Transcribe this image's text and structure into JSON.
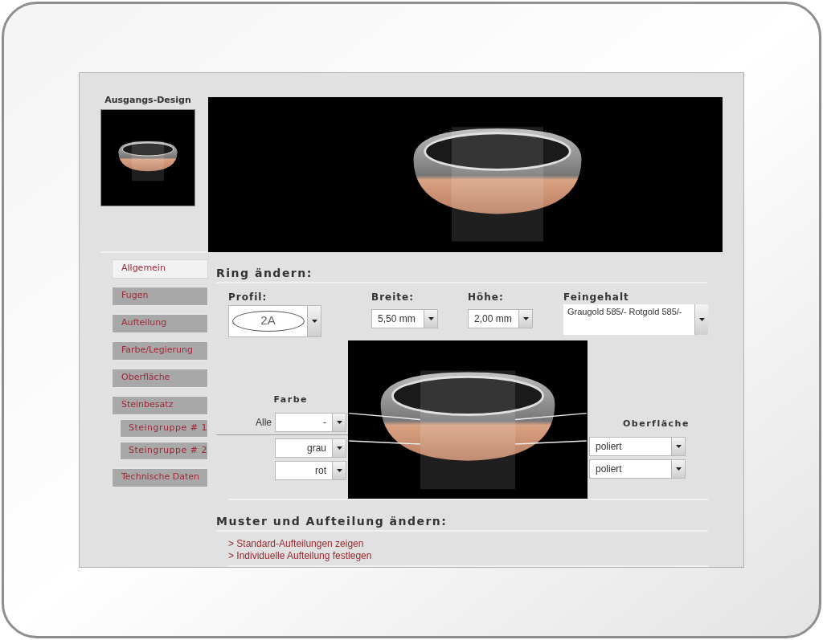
{
  "thumbnail": {
    "title": "Ausgangs-Design"
  },
  "nav": {
    "items": [
      {
        "label": "Allgemein",
        "selected": true
      },
      {
        "label": "Fugen",
        "selected": false
      },
      {
        "label": "Aufteilung",
        "selected": false
      },
      {
        "label": "Farbe/Legierung",
        "selected": false
      },
      {
        "label": "Oberfläche",
        "selected": false
      },
      {
        "label": "Steinbesatz",
        "selected": false,
        "children": [
          {
            "label": "Steingruppe # 1",
            "selected": false
          },
          {
            "label": "Steingruppe # 2",
            "selected": false
          }
        ]
      },
      {
        "label": "Technische Daten",
        "selected": false
      }
    ]
  },
  "ring_section": {
    "title": "Ring ändern:",
    "profil": {
      "label": "Profil:",
      "value": "2A"
    },
    "breite": {
      "label": "Breite:",
      "value": "5,50 mm"
    },
    "hoehe": {
      "label": "Höhe:",
      "value": "2,00 mm"
    },
    "feingehalt": {
      "label": "Feingehalt",
      "value": "Graugold 585/- Rotgold 585/-"
    },
    "farbe": {
      "title": "Farbe",
      "all": {
        "label": "Alle",
        "value": "-"
      },
      "rows": [
        {
          "value": "grau"
        },
        {
          "value": "rot"
        }
      ]
    },
    "oberflaeche": {
      "title": "Oberfläche",
      "rows": [
        {
          "value": "poliert"
        },
        {
          "value": "poliert"
        }
      ]
    }
  },
  "pattern_section": {
    "title": "Muster und Aufteilung ändern:",
    "links": [
      "> Standard-Aufteilungen zeigen",
      "> Individuelle Aufteilung festlegen"
    ]
  }
}
